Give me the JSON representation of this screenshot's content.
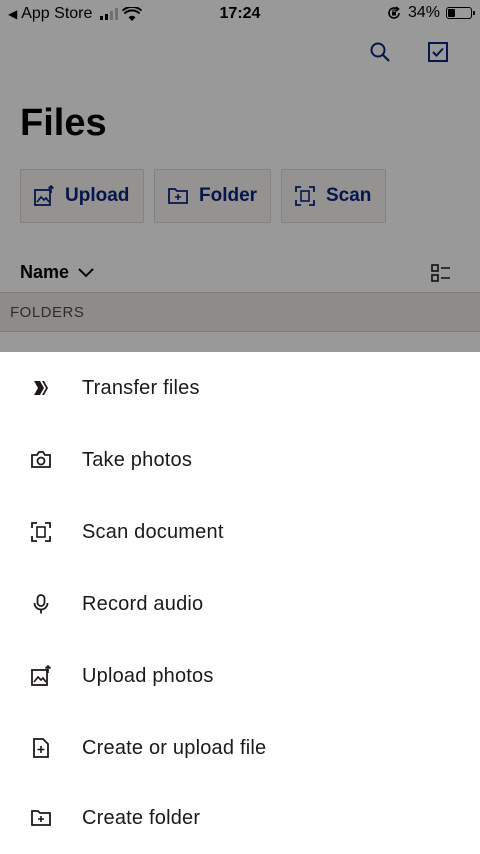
{
  "status_bar": {
    "back_app": "App Store",
    "time": "17:24",
    "battery_percent": "34%",
    "battery_level": 0.34
  },
  "top_actions": {
    "search_icon": "search-icon",
    "select_icon": "checkbox-icon"
  },
  "page": {
    "title": "Files"
  },
  "actions": [
    {
      "label": "Upload",
      "icon": "upload-photo-icon"
    },
    {
      "label": "Folder",
      "icon": "folder-plus-icon"
    },
    {
      "label": "Scan",
      "icon": "scan-icon"
    }
  ],
  "sort": {
    "label": "Name"
  },
  "section": {
    "folders": "FOLDERS"
  },
  "sheet": {
    "items": [
      {
        "label": "Transfer files",
        "icon": "transfer-icon"
      },
      {
        "label": "Take photos",
        "icon": "camera-icon"
      },
      {
        "label": "Scan document",
        "icon": "scan-icon"
      },
      {
        "label": "Record audio",
        "icon": "microphone-icon"
      },
      {
        "label": "Upload photos",
        "icon": "upload-photo-icon"
      },
      {
        "label": "Create or upload file",
        "icon": "file-plus-icon"
      },
      {
        "label": "Create folder",
        "icon": "folder-plus-icon"
      }
    ]
  },
  "colors": {
    "accent": "#0d2481",
    "sheet_text": "#1e1919",
    "overlay": "rgba(0,0,0,0.4)"
  }
}
